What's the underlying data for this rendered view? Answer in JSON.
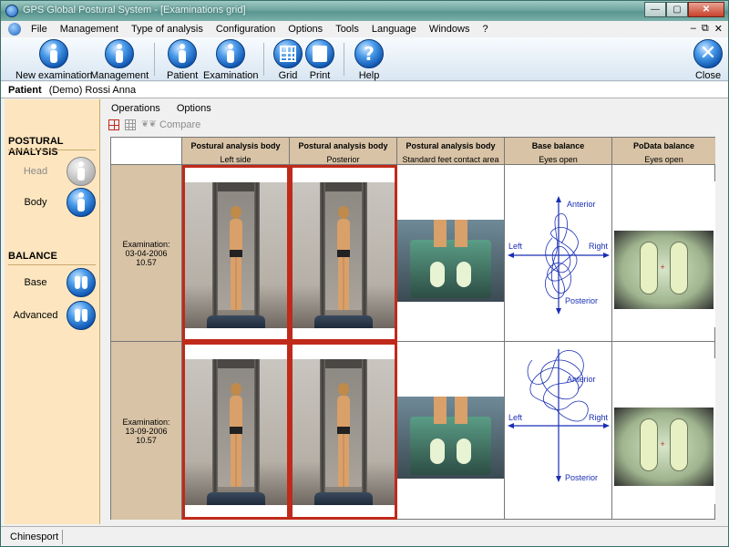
{
  "window": {
    "title": "GPS Global Postural System - [Examinations grid]"
  },
  "menu": {
    "items": [
      "File",
      "Management",
      "Type of analysis",
      "Configuration",
      "Options",
      "Tools",
      "Language",
      "Windows",
      "?"
    ]
  },
  "toolbar": {
    "new_examination": "New examination",
    "management": "Management",
    "patient": "Patient",
    "examination": "Examination",
    "grid": "Grid",
    "print": "Print",
    "help": "Help",
    "close": "Close"
  },
  "patient": {
    "label": "Patient",
    "value": "(Demo) Rossi Anna"
  },
  "sidebar": {
    "postural_title": "POSTURAL ANALYSIS",
    "head": "Head",
    "body": "Body",
    "balance_title": "BALANCE",
    "base": "Base",
    "advanced": "Advanced"
  },
  "content": {
    "menu": [
      "Operations",
      "Options"
    ],
    "compare_label": "Compare"
  },
  "grid": {
    "columns": [
      {
        "title": "Postural analysis  body",
        "subtitle": "Left side"
      },
      {
        "title": "Postural analysis  body",
        "subtitle": "Posterior"
      },
      {
        "title": "Postural analysis  body",
        "subtitle": "Standard feet contact area"
      },
      {
        "title": "Base balance",
        "subtitle": "Eyes open"
      },
      {
        "title": "PoData balance",
        "subtitle": "Eyes open"
      }
    ],
    "rows": [
      {
        "label": "Examination: 03-04-2006 10.57"
      },
      {
        "label": "Examination: 13-09-2006 10.57"
      }
    ],
    "stabilogram_labels": {
      "anterior": "Anterior",
      "posterior": "Posterior",
      "left": "Left",
      "right": "Right"
    }
  },
  "status": {
    "text": "Chinesport"
  }
}
